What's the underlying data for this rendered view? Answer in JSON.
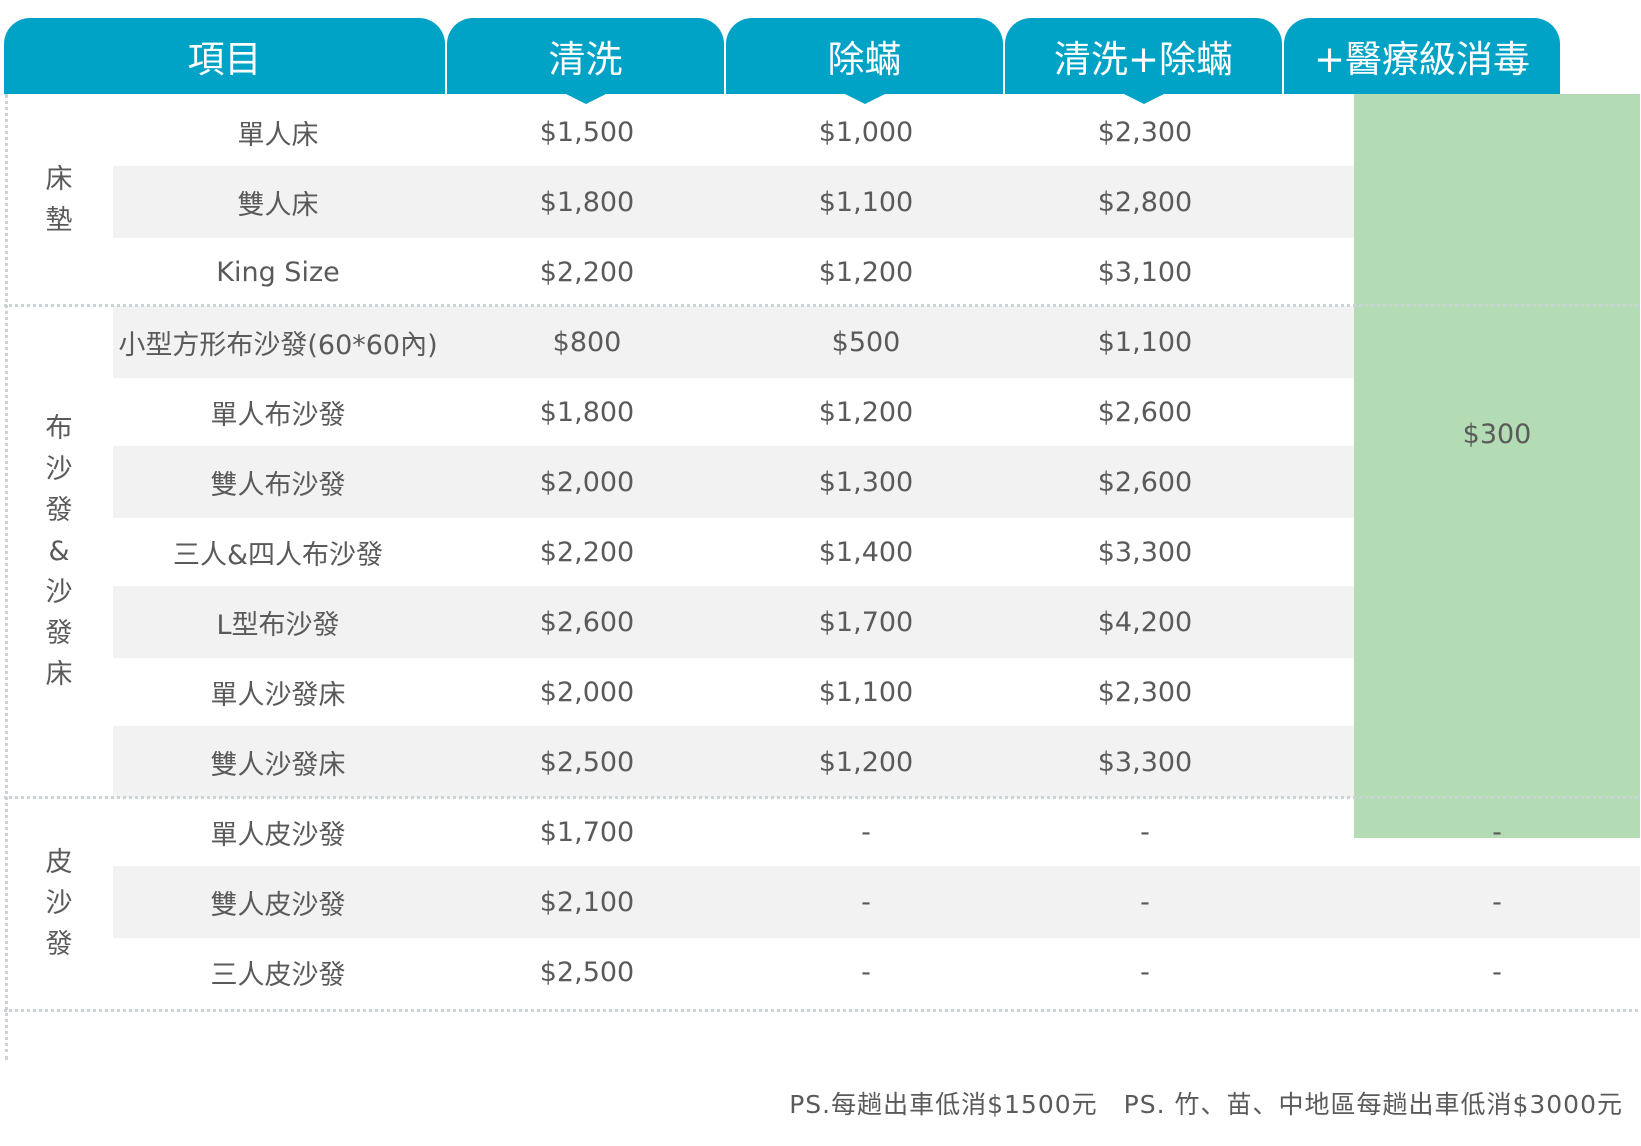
{
  "headers": [
    "項目",
    "清洗",
    "除蟎",
    "清洗+除蟎",
    "+醫療級消毒"
  ],
  "categories": [
    {
      "chars": [
        "床",
        "墊"
      ]
    },
    {
      "chars": [
        "布",
        "沙",
        "發",
        "&",
        "沙",
        "發",
        "床"
      ]
    },
    {
      "chars": [
        "皮",
        "沙",
        "發"
      ]
    }
  ],
  "rows": [
    {
      "item": "單人床",
      "clean": "$1,500",
      "mite": "$1,000",
      "both": "$2,300",
      "disinfect": ""
    },
    {
      "item": "雙人床",
      "clean": "$1,800",
      "mite": "$1,100",
      "both": "$2,800",
      "disinfect": ""
    },
    {
      "item": "King Size",
      "clean": "$2,200",
      "mite": "$1,200",
      "both": "$3,100",
      "disinfect": ""
    },
    {
      "item": "小型方形布沙發(60*60內)",
      "clean": "$800",
      "mite": "$500",
      "both": "$1,100",
      "disinfect": ""
    },
    {
      "item": "單人布沙發",
      "clean": "$1,800",
      "mite": "$1,200",
      "both": "$2,600",
      "disinfect": ""
    },
    {
      "item": "雙人布沙發",
      "clean": "$2,000",
      "mite": "$1,300",
      "both": "$2,600",
      "disinfect": ""
    },
    {
      "item": "三人&四人布沙發",
      "clean": "$2,200",
      "mite": "$1,400",
      "both": "$3,300",
      "disinfect": ""
    },
    {
      "item": "L型布沙發",
      "clean": "$2,600",
      "mite": "$1,700",
      "both": "$4,200",
      "disinfect": ""
    },
    {
      "item": "單人沙發床",
      "clean": "$2,000",
      "mite": "$1,100",
      "both": "$2,300",
      "disinfect": ""
    },
    {
      "item": "雙人沙發床",
      "clean": "$2,500",
      "mite": "$1,200",
      "both": "$3,300",
      "disinfect": ""
    },
    {
      "item": "單人皮沙發",
      "clean": "$1,700",
      "mite": "-",
      "both": "-",
      "disinfect": "-"
    },
    {
      "item": "雙人皮沙發",
      "clean": "$2,100",
      "mite": "-",
      "both": "-",
      "disinfect": "-"
    },
    {
      "item": "三人皮沙發",
      "clean": "$2,500",
      "mite": "-",
      "both": "-",
      "disinfect": "-"
    }
  ],
  "disinfect_price": "$300",
  "footnote": {
    "note1": "PS.每趟出車低消$1500元",
    "note2": "PS. 竹、苗、中地區每趟出車低消$3000元"
  },
  "colors": {
    "header_bg": "#00a3c6",
    "header_text": "#ffffff",
    "stripe_bg": "#f2f2f2",
    "disinfect_bg": "#b3dcb4",
    "text": "#5a5a5a"
  }
}
